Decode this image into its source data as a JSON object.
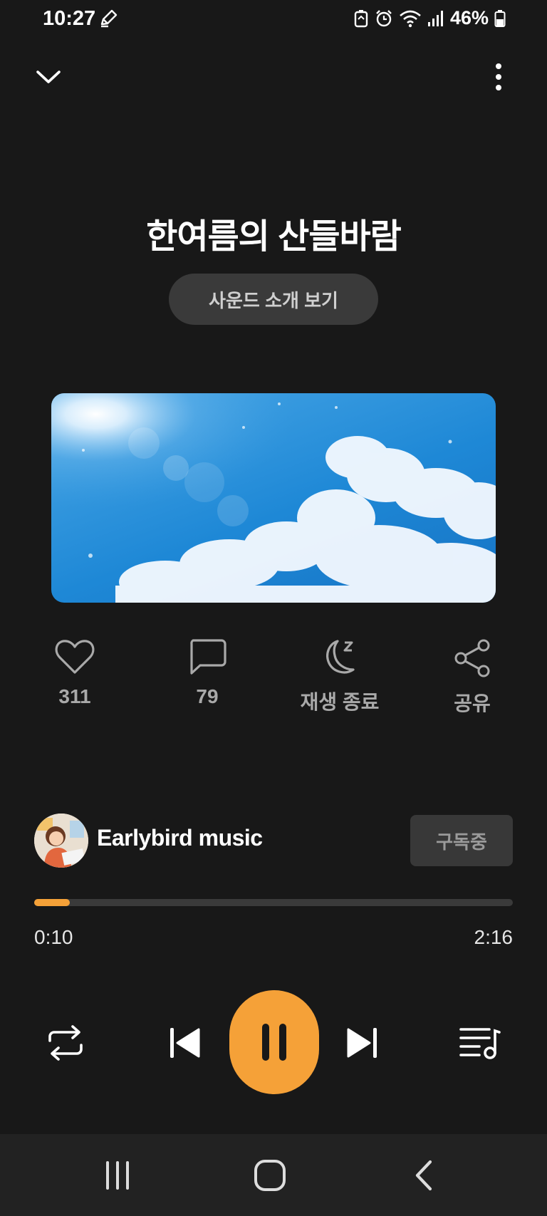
{
  "status_bar": {
    "time": "10:27",
    "battery": "46%",
    "icons": [
      "pen-icon",
      "battery-saver-icon",
      "alarm-icon",
      "wifi-icon",
      "signal-icon",
      "battery-icon"
    ]
  },
  "header": {
    "collapse_icon": "chevron-down-icon",
    "more_icon": "more-vertical-icon"
  },
  "track": {
    "title": "한여름의 산들바람",
    "intro_button": "사운드 소개 보기"
  },
  "actions": {
    "like_count": "311",
    "comment_count": "79",
    "sleep_timer_label": "재생 종료",
    "share_label": "공유"
  },
  "channel": {
    "name": "Earlybird music",
    "subscribe_label": "구독중"
  },
  "playback": {
    "current_time": "0:10",
    "total_time": "2:16",
    "progress_fraction": 0.074,
    "state": "playing"
  },
  "colors": {
    "accent": "#f5a138",
    "background": "#181818"
  },
  "nav_bar": {
    "icons": [
      "recent-apps-icon",
      "home-icon",
      "back-icon"
    ]
  }
}
